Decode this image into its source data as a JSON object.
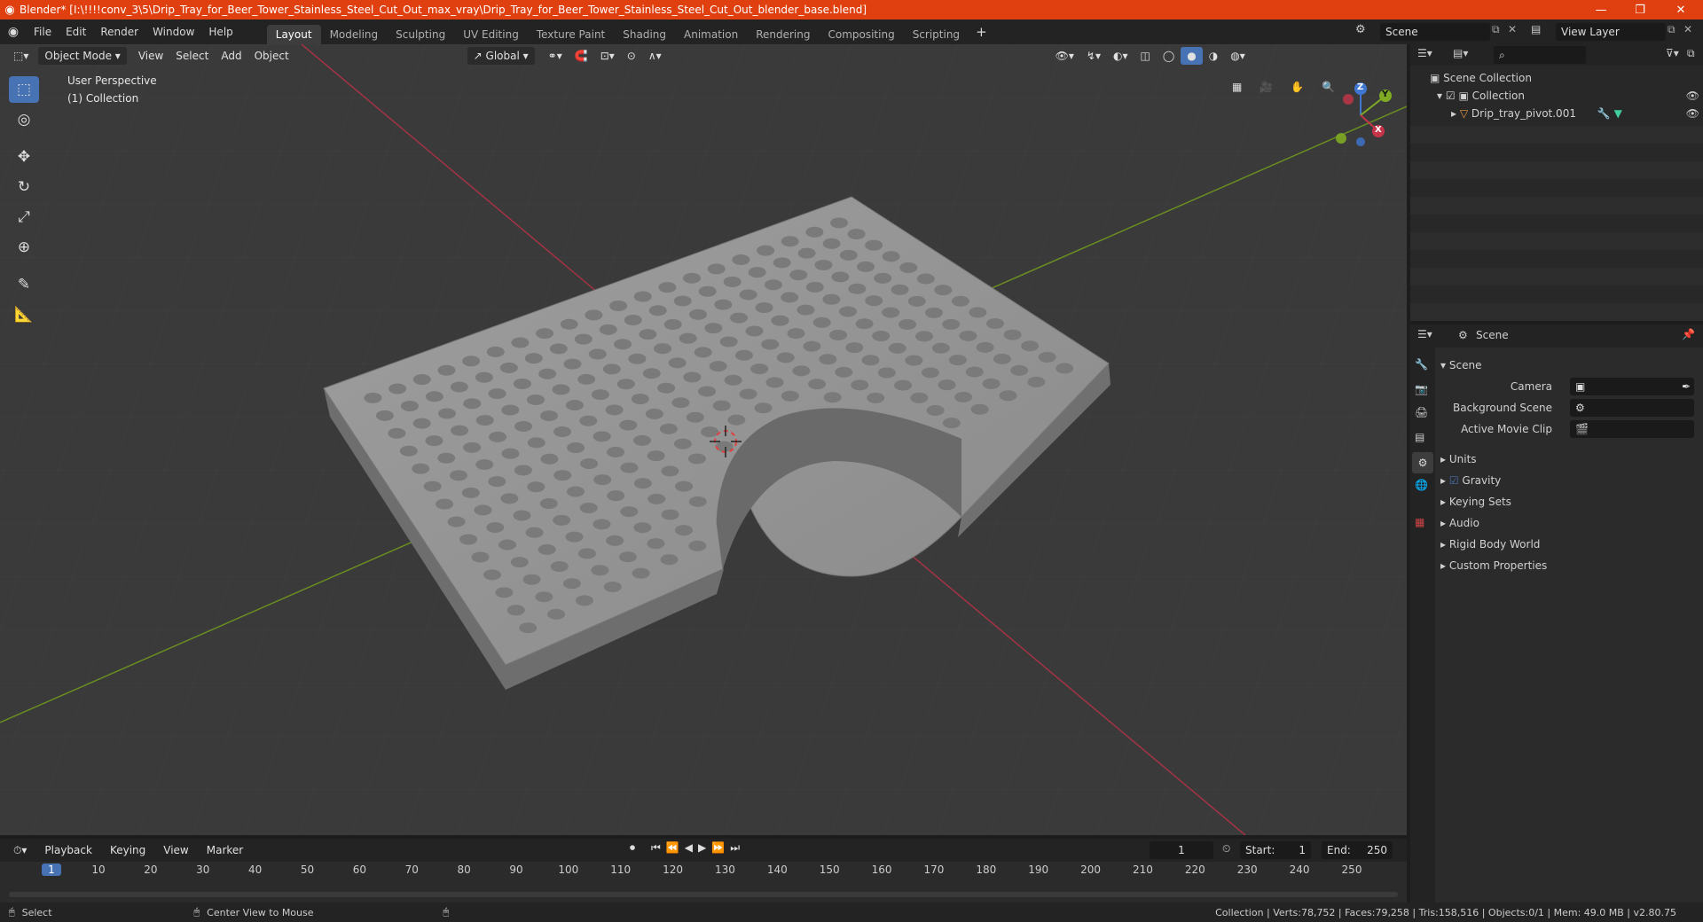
{
  "window": {
    "title": "Blender* [I:\\!!!!conv_3\\5\\Drip_Tray_for_Beer_Tower_Stainless_Steel_Cut_Out_max_vray\\Drip_Tray_for_Beer_Tower_Stainless_Steel_Cut_Out_blender_base.blend]",
    "minimize": "—",
    "maximize": "❐",
    "close": "✕"
  },
  "menus": [
    "File",
    "Edit",
    "Render",
    "Window",
    "Help"
  ],
  "workspaces": [
    "Layout",
    "Modeling",
    "Sculpting",
    "UV Editing",
    "Texture Paint",
    "Shading",
    "Animation",
    "Rendering",
    "Compositing",
    "Scripting"
  ],
  "add_workspace": "+",
  "scene_field": "Scene",
  "view_layer_field": "View Layer",
  "viewport": {
    "mode": "Object Mode",
    "menu": [
      "View",
      "Select",
      "Add",
      "Object"
    ],
    "transform_orientation": "Global",
    "overlay_text_1": "User Perspective",
    "overlay_text_2": "(1) Collection",
    "gizmo": {
      "x": "X",
      "y": "Y",
      "z": "Z"
    }
  },
  "outliner": {
    "root": "Scene Collection",
    "collection": "Collection",
    "object": "Drip_tray_pivot.001"
  },
  "properties": {
    "header": "Scene",
    "panel_title": "Scene",
    "camera_label": "Camera",
    "background_scene_label": "Background Scene",
    "active_movie_clip_label": "Active Movie Clip",
    "sections": [
      "Units",
      "Gravity",
      "Keying Sets",
      "Audio",
      "Rigid Body World",
      "Custom Properties"
    ]
  },
  "timeline": {
    "menu": [
      "Playback",
      "Keying",
      "View",
      "Marker"
    ],
    "current_frame": "1",
    "start_label": "Start:",
    "start_value": "1",
    "end_label": "End:",
    "end_value": "250",
    "ruler": [
      "1",
      "10",
      "20",
      "30",
      "40",
      "50",
      "60",
      "70",
      "80",
      "90",
      "100",
      "110",
      "120",
      "130",
      "140",
      "150",
      "160",
      "170",
      "180",
      "190",
      "200",
      "210",
      "220",
      "230",
      "240",
      "250"
    ]
  },
  "statusbar": {
    "left_action": "Select",
    "middle_action": "Center View to Mouse",
    "stats": "Collection | Verts:78,752 | Faces:79,258 | Tris:158,516 | Objects:0/1 | Mem: 49.0 MB | v2.80.75"
  },
  "colors": {
    "titlebar": "#e0400f",
    "accent": "#4772b3",
    "viewport_bg": "#3a3a3a",
    "axis_x": "#c5354a",
    "axis_y": "#7faa24"
  }
}
